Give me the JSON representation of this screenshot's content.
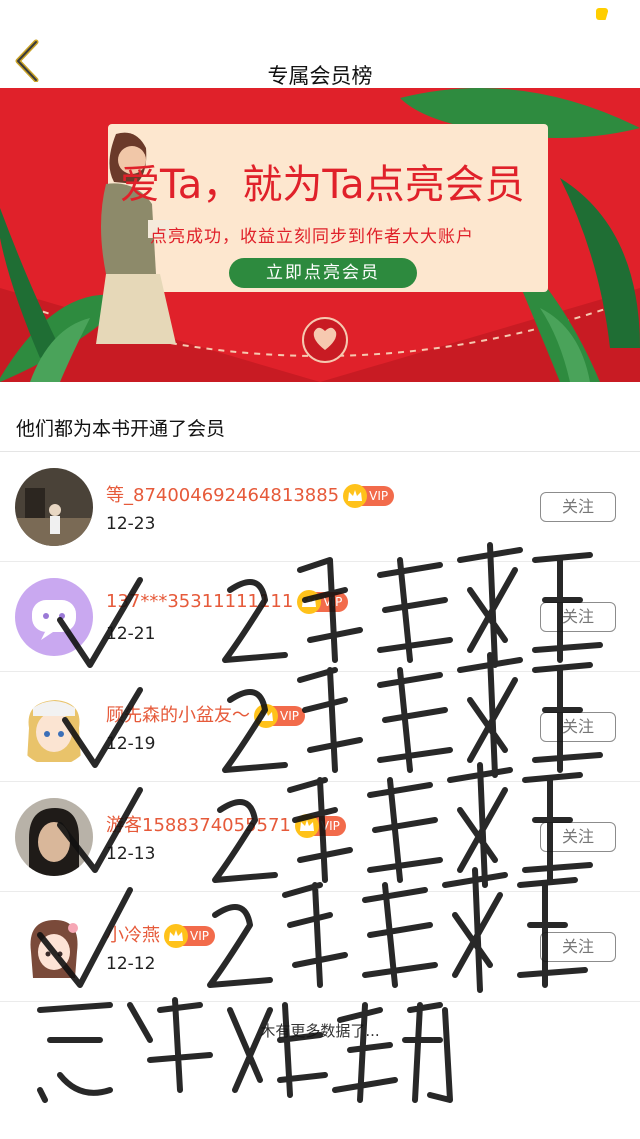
{
  "header": {
    "title": "专属会员榜",
    "back_icon": "chevron-left-icon",
    "accent_color": "#ffce00"
  },
  "banner": {
    "headline": "爱Ta，就为Ta点亮会员",
    "subtext": "点亮成功，收益立刻同步到作者大大账户",
    "cta_label": "立即点亮会员",
    "background_color": "#e0212a",
    "card_color": "#fde7cf",
    "cta_color": "#2d8a3e"
  },
  "section": {
    "title": "他们都为本书开通了会员"
  },
  "members": [
    {
      "name": "等_874004692464813885",
      "vip_label": "VIP",
      "date": "12-23",
      "follow_label": "关注",
      "avatar": "photo-avatar"
    },
    {
      "name": "137***35311111111",
      "vip_label": "VIP",
      "date": "12-21",
      "follow_label": "关注",
      "avatar": "default-avatar"
    },
    {
      "name": "顾先森的小盆友～",
      "vip_label": "VIP",
      "date": "12-19",
      "follow_label": "关注",
      "avatar": "anime-girl-avatar"
    },
    {
      "name": "游客1588374055571",
      "vip_label": "VIP",
      "date": "12-13",
      "follow_label": "关注",
      "avatar": "photo-avatar"
    },
    {
      "name": "小冷燕",
      "vip_label": "VIP",
      "date": "12-12",
      "follow_label": "关注",
      "avatar": "anime-girl-avatar"
    }
  ],
  "footer": {
    "note": "木有更多数据了..."
  },
  "handwriting": {
    "row_note": "2篇更新完毕",
    "closing_note": "感谢姐妹们",
    "checkmark_icon": "checkmark-icon"
  },
  "colors": {
    "name_color": "#e65a3a",
    "vip_badge": "#f26b4b",
    "crown": "#ffc21a"
  }
}
